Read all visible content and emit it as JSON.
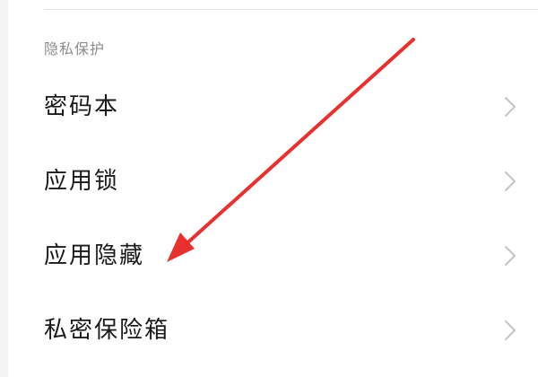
{
  "section": {
    "title": "隐私保护"
  },
  "items": [
    {
      "label": "密码本"
    },
    {
      "label": "应用锁"
    },
    {
      "label": "应用隐藏"
    },
    {
      "label": "私密保险箱"
    }
  ],
  "icons": {
    "chevron": "chevron-right-icon",
    "annotation": "red-arrow-annotation"
  },
  "colors": {
    "text": "#1a1a1a",
    "section_text": "#8c8c8c",
    "chevron": "#c4c4c4",
    "annotation_arrow": "#e8312f",
    "background": "#ffffff"
  }
}
